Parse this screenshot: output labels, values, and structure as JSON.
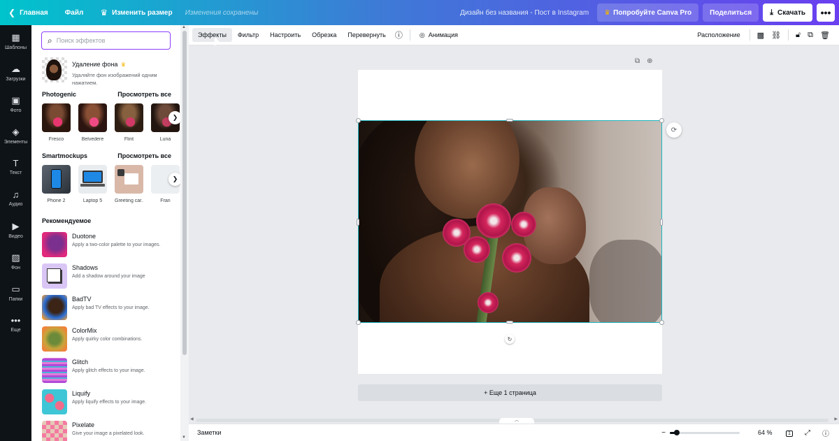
{
  "topbar": {
    "back_label": "Главная",
    "file_label": "Файл",
    "resize_label": "Изменить размер",
    "saved_status": "Изменения сохранены",
    "doc_title": "Дизайн без названия - Пост в Instagram",
    "try_pro_label": "Попробуйте Canva Pro",
    "share_label": "Поделиться",
    "download_label": "Скачать"
  },
  "rail": {
    "items": [
      {
        "label": "Шаблоны",
        "icon": "layout-icon"
      },
      {
        "label": "Загрузки",
        "icon": "cloud-upload-icon"
      },
      {
        "label": "Фото",
        "icon": "image-icon"
      },
      {
        "label": "Элементы",
        "icon": "shapes-icon"
      },
      {
        "label": "Текст",
        "icon": "text-icon"
      },
      {
        "label": "Аудио",
        "icon": "music-icon"
      },
      {
        "label": "Видео",
        "icon": "video-icon"
      },
      {
        "label": "Фон",
        "icon": "pattern-icon"
      },
      {
        "label": "Папки",
        "icon": "folder-icon"
      },
      {
        "label": "Еще",
        "icon": "more-icon"
      }
    ]
  },
  "panel": {
    "search_placeholder": "Поиск эффектов",
    "bg_remove": {
      "title": "Удаление фона",
      "desc": "Удаляйте фон изображений одним нажатием."
    },
    "photogenic": {
      "title": "Photogenic",
      "see_all": "Просмотреть все",
      "items": [
        "Fresco",
        "Belvedere",
        "Flint",
        "Luna"
      ]
    },
    "smartmockups": {
      "title": "Smartmockups",
      "see_all": "Просмотреть все",
      "items": [
        "Phone 2",
        "Laptop 5",
        "Greeting car...",
        "Fran"
      ]
    },
    "recommended": {
      "title": "Рекомендуемое",
      "items": [
        {
          "title": "Duotone",
          "desc": "Apply a two-color palette to your images."
        },
        {
          "title": "Shadows",
          "desc": "Add a shadow around your image"
        },
        {
          "title": "BadTV",
          "desc": "Apply bad TV effects to your image."
        },
        {
          "title": "ColorMix",
          "desc": "Apply quirky color combinations."
        },
        {
          "title": "Glitch",
          "desc": "Apply glitch effects to your image."
        },
        {
          "title": "Liquify",
          "desc": "Apply liquify effects to your image."
        },
        {
          "title": "Pixelate",
          "desc": "Give your image a pixelated look."
        }
      ]
    }
  },
  "context_toolbar": {
    "effects": "Эффекты",
    "filter": "Фильтр",
    "adjust": "Настроить",
    "crop": "Обрезка",
    "flip": "Перевернуть",
    "animate": "Анимация",
    "position": "Расположение"
  },
  "canvas": {
    "add_page": "+ Еще 1 страница"
  },
  "bottombar": {
    "notes": "Заметки",
    "zoom": "64 %",
    "zoom_fraction": 0.1,
    "page_count": "1"
  },
  "colors": {
    "accent": "#8b3dff",
    "selection": "#1fb7c2",
    "rail_bg": "#0e1318"
  }
}
